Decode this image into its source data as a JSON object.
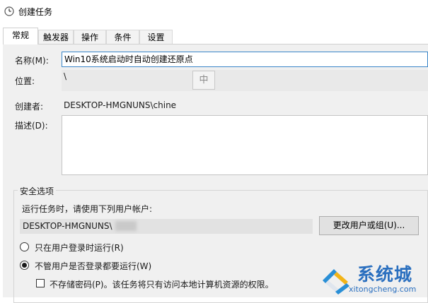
{
  "window": {
    "title": "创建任务",
    "icon": "clock-icon"
  },
  "tabs": [
    {
      "label": "常规",
      "active": true
    },
    {
      "label": "触发器",
      "active": false
    },
    {
      "label": "操作",
      "active": false
    },
    {
      "label": "条件",
      "active": false
    },
    {
      "label": "设置",
      "active": false
    }
  ],
  "general": {
    "name_label": "名称(M):",
    "name_value": "Win10系统启动时自动创建还原点",
    "location_label": "位置:",
    "location_value": "\\",
    "ime_indicator": "中",
    "author_label": "创建者:",
    "author_value": "DESKTOP-HMGNUNS\\chine",
    "description_label": "描述(D):",
    "description_value": ""
  },
  "security": {
    "group_title": "安全选项",
    "run_as_prompt": "运行任务时，请使用下列用户帐户:",
    "account_value": "DESKTOP-HMGNUNS\\",
    "change_user_button": "更改用户或组(U)...",
    "radio_logged_on": "只在用户登录时运行(R)",
    "radio_whether_logged": "不管用户是否登录都要运行(W)",
    "selected_radio": "radio_whether_logged",
    "no_store_password": "不存储密码(P)。该任务将只有访问本地计算机资源的权限。",
    "no_store_password_checked": false
  },
  "watermark": {
    "brand": "系统城",
    "url": "xitongcheng.com"
  },
  "colors": {
    "accent_border": "#3a86c8",
    "panel_bg": "#f0f0f0",
    "watermark_blue": "#2a6fbf"
  }
}
